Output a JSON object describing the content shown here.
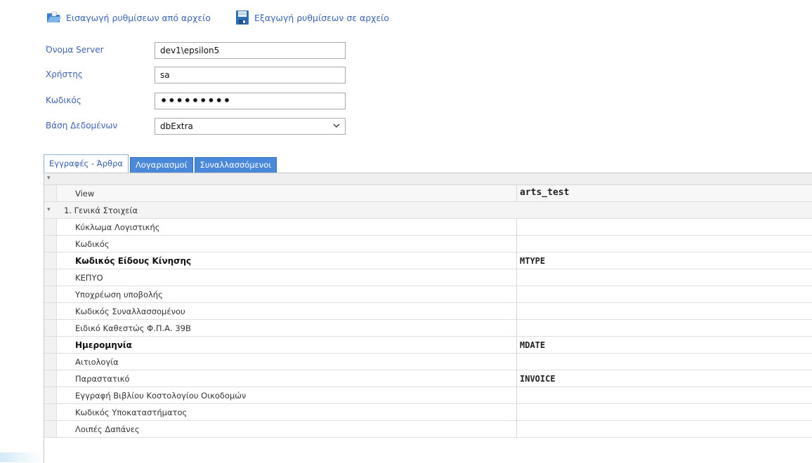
{
  "toolbar": {
    "import_label": "Εισαγωγή ρυθμίσεων από αρχείο",
    "export_label": "Εξαγωγή ρυθμίσεων σε αρχείο",
    "import_icon": "folder-open-icon",
    "export_icon": "floppy-disk-icon"
  },
  "form": {
    "server_label": "Όνομα Server",
    "server_value": "dev1\\epsilon5",
    "user_label": "Χρήστης",
    "user_value": "sa",
    "password_label": "Κωδικός",
    "password_value": "•••••••••",
    "database_label": "Βάση Δεδομένων",
    "database_value": "dbExtra"
  },
  "tabs": [
    {
      "label": "Εγγραφές - Άρθρα",
      "active": true
    },
    {
      "label": "Λογαριασμοί",
      "active": false
    },
    {
      "label": "Συναλλασσόμενοι",
      "active": false
    }
  ],
  "grid": {
    "header_name": "View",
    "header_value": "arts_test",
    "group_label": "1. Γενικά Στοιχεία",
    "rows": [
      {
        "name": "Κύκλωμα Λογιστικής",
        "value": ""
      },
      {
        "name": "Κωδικός",
        "value": ""
      },
      {
        "name": "Κωδικός Είδους Κίνησης",
        "value": "MTYPE"
      },
      {
        "name": "ΚΕΠΥΟ",
        "value": ""
      },
      {
        "name": "Υποχρέωση υποβολής",
        "value": ""
      },
      {
        "name": "Κωδικός Συναλλασσομένου",
        "value": ""
      },
      {
        "name": "Ειδικό Καθεστώς Φ.Π.Α. 39Β",
        "value": ""
      },
      {
        "name": "Ημερομηνία",
        "value": "MDATE"
      },
      {
        "name": "Αιτιολογία",
        "value": ""
      },
      {
        "name": "Παραστατικό",
        "value": "INVOICE"
      },
      {
        "name": "Εγγραφή Βιβλίου Κοστολογίου Οικοδομών",
        "value": ""
      },
      {
        "name": "Κωδικός Υποκαταστήματος",
        "value": ""
      },
      {
        "name": "Λοιπές Δαπάνες",
        "value": ""
      }
    ]
  },
  "colors": {
    "tab_inactive_bg": "#4a88d9",
    "label_text": "#3f63b4"
  }
}
